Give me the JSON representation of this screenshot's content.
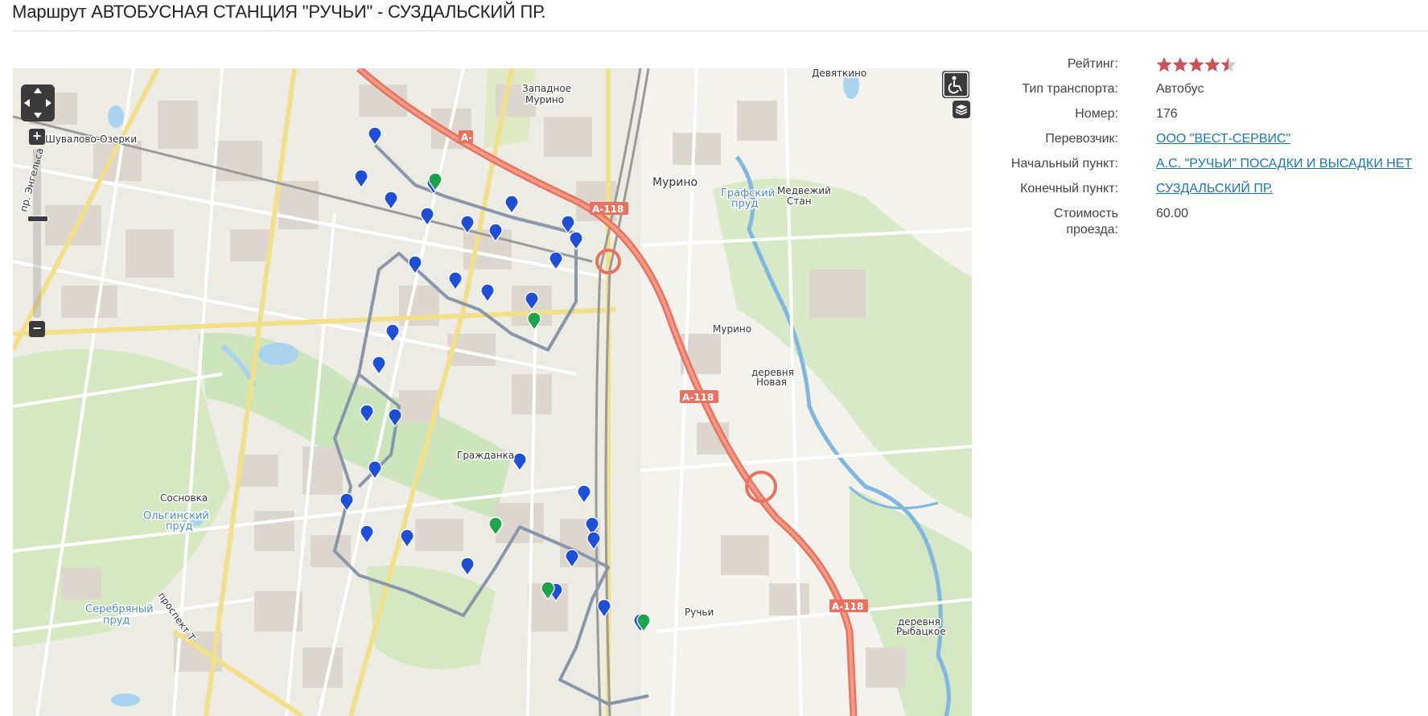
{
  "page": {
    "title": "Маршрут АВТОБУСНАЯ СТАНЦИЯ \"РУЧЬИ\" - СУЗДАЛЬСКИЙ ПР."
  },
  "details": {
    "rating": {
      "label": "Рейтинг:",
      "value": 4.5,
      "max": 5,
      "star_color": "#c9525a",
      "empty_color": "#cccccc"
    },
    "transport_type": {
      "label": "Тип транспорта:",
      "value": "Автобус"
    },
    "number": {
      "label": "Номер:",
      "value": "176"
    },
    "carrier": {
      "label": "Перевозчик:",
      "value": "ООО \"ВЕСТ-СЕРВИС\""
    },
    "start_point": {
      "label": "Начальный пункт:",
      "value": "А.С. \"РУЧЬИ\" ПОСАДКИ И ВЫСАДКИ НЕТ"
    },
    "end_point": {
      "label": "Конечный пункт:",
      "value": "СУЗДАЛЬСКИЙ ПР."
    },
    "fare": {
      "label_line1": "Стоимость",
      "label_line2": "проезда:",
      "value": "60.00"
    }
  },
  "map": {
    "controls": {
      "zoom_in": "+",
      "zoom_out": "−",
      "accessibility_icon": "wheelchair-icon",
      "layers_icon": "layers-icon"
    },
    "place_labels": {
      "shuvalovo": "Шувалово-Озерки",
      "engelsa": "пр. Энгельса",
      "zapadnoe_murino_1": "Западное",
      "zapadnoe_murino_2": "Мурино",
      "devyatkino": "Девяткино",
      "murino": "Мурино",
      "grafsky_prud_1": "Графский",
      "grafsky_prud_2": "пруд",
      "medvezhy_1": "Медвежий",
      "medvezhy_2": "Стан",
      "murino_2": "Мурино",
      "novaya_1": "деревня",
      "novaya_2": "Новая",
      "grazhdanka": "Гражданка",
      "sosnovka": "Сосновка",
      "olginsky_1": "Ольгинский",
      "olginsky_2": "пруд",
      "serebryany_1": "Серебряный",
      "serebryany_2": "пруд",
      "prospekt": "проспект Т",
      "ruchyi": "Ручьи",
      "rybatskoe_1": "деревня",
      "rybatskoe_2": "Рыбацкое"
    },
    "road_shields": [
      "А-",
      "А-118",
      "А-118",
      "А-118"
    ],
    "colors": {
      "route_line": "#8a97a8",
      "stop_marker": "#1f4fd6",
      "terminal_marker": "#1fa34a",
      "highway": "#e8715f",
      "water": "#a9d3ee",
      "park": "#c8e3b4"
    }
  }
}
